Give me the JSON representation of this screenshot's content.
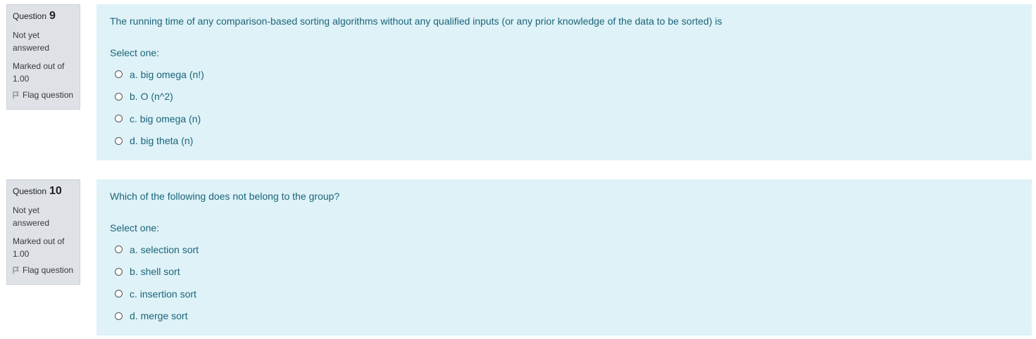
{
  "questions": [
    {
      "label": "Question",
      "number": "9",
      "state": "Not yet answered",
      "grade": "Marked out of 1.00",
      "flag_label": "Flag question",
      "text": "The running time of any comparison-based sorting algorithms without any qualified inputs (or any prior knowledge of the data to be sorted) is",
      "prompt": "Select one:",
      "options": [
        "a. big omega (n!)",
        "b. O (n^2)",
        "c. big omega (n)",
        "d. big theta (n)"
      ]
    },
    {
      "label": "Question",
      "number": "10",
      "state": "Not yet answered",
      "grade": "Marked out of 1.00",
      "flag_label": "Flag question",
      "text": "Which of the following does not belong to the group?",
      "prompt": "Select one:",
      "options": [
        "a. selection sort",
        "b. shell sort",
        "c. insertion sort",
        "d. merge sort"
      ]
    }
  ],
  "icons": {
    "flag": "flag-icon",
    "radio": "radio-button"
  },
  "colors": {
    "info_bg": "#dee2e6",
    "content_bg": "#def2f8",
    "text": "#1c6478"
  }
}
